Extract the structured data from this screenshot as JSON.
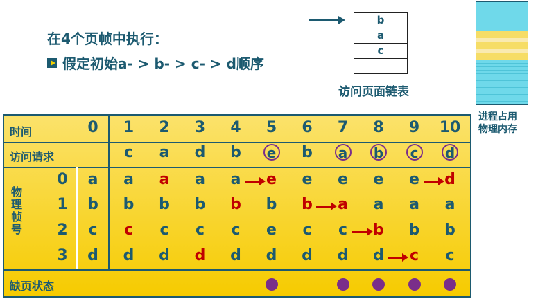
{
  "heading": {
    "title": "在4个页帧中执行：",
    "subtitle": "假定初始a- > b- > c- > d顺序"
  },
  "linked_list": {
    "items": [
      "b",
      "a",
      "c",
      ""
    ],
    "caption": "访问页面链表"
  },
  "memory": {
    "caption_line1": "进程占用",
    "caption_line2": "物理内存",
    "colors": {
      "cyan": "#6fd9ea",
      "yellow": "#f6dd66",
      "pale": "#f9eab0"
    }
  },
  "table": {
    "time_label": "时间",
    "access_label": "访问请求",
    "frame_label": "物理帧号",
    "fault_label": "缺页状态",
    "times": [
      "0",
      "1",
      "2",
      "3",
      "4",
      "5",
      "6",
      "7",
      "8",
      "9",
      "10"
    ],
    "requests": [
      "c",
      "a",
      "d",
      "b",
      "e",
      "b",
      "a",
      "b",
      "c",
      "d"
    ],
    "circled_requests": [
      5,
      7,
      8,
      9,
      10
    ],
    "frames": [
      {
        "id": "0",
        "cells": [
          "a",
          "a",
          "a",
          "a",
          "a",
          "e",
          "e",
          "e",
          "e",
          "e",
          "d"
        ]
      },
      {
        "id": "1",
        "cells": [
          "b",
          "b",
          "b",
          "b",
          "b",
          "b",
          "b",
          "a",
          "a",
          "a",
          "a"
        ]
      },
      {
        "id": "2",
        "cells": [
          "c",
          "c",
          "c",
          "c",
          "c",
          "e",
          "c",
          "c",
          "b",
          "b",
          "b"
        ]
      },
      {
        "id": "3",
        "cells": [
          "d",
          "d",
          "d",
          "d",
          "d",
          "d",
          "d",
          "d",
          "d",
          "c",
          "c"
        ]
      }
    ],
    "faults": [
      5,
      7,
      8,
      9,
      10
    ],
    "colors": {
      "text": "#1c5a70",
      "highlight": "#c00000",
      "fault": "#7a2e8a",
      "background": "#f6cb00"
    }
  }
}
